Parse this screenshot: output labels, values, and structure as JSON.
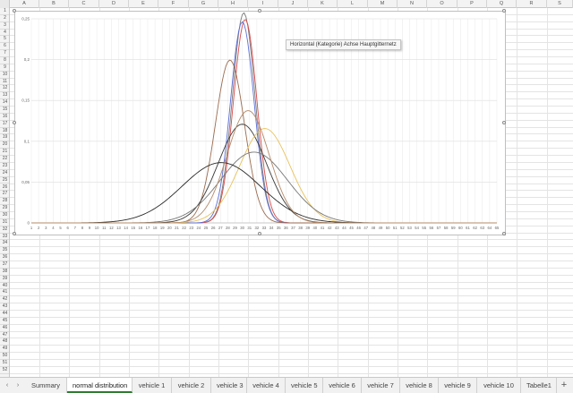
{
  "spreadsheet": {
    "columns": [
      "A",
      "B",
      "C",
      "D",
      "E",
      "F",
      "G",
      "H",
      "I",
      "J",
      "K",
      "L",
      "M",
      "N",
      "O",
      "P",
      "Q",
      "R",
      "S"
    ],
    "rows": [
      "1",
      "2",
      "3",
      "4",
      "5",
      "6",
      "7",
      "8",
      "9",
      "10",
      "11",
      "12",
      "13",
      "14",
      "15",
      "16",
      "17",
      "18",
      "19",
      "20",
      "21",
      "22",
      "23",
      "24",
      "25",
      "26",
      "27",
      "28",
      "29",
      "30",
      "31",
      "32",
      "33",
      "34",
      "35",
      "36",
      "37",
      "38",
      "39",
      "40",
      "41",
      "42",
      "43",
      "44",
      "45",
      "46",
      "47",
      "48",
      "49",
      "50",
      "51",
      "52"
    ]
  },
  "tooltip": {
    "text": "Horizontal (Kategorie) Achse Hauptgitternetz"
  },
  "sheet_tabs": {
    "prev_arrow": "‹",
    "next_arrow": "›",
    "add_label": "+",
    "active": "normal distribution",
    "tabs": [
      "Summary",
      "normal distribution",
      "vehicle 1",
      "vehicle 2",
      "vehicle 3",
      "vehicle 4",
      "vehicle 5",
      "vehicle 6",
      "vehicle 7",
      "vehicle 8",
      "vehicle 9",
      "vehicle 10",
      "Tabelle1"
    ]
  },
  "chart_data": {
    "type": "line",
    "x": [
      1,
      2,
      3,
      4,
      5,
      6,
      7,
      8,
      9,
      10,
      11,
      12,
      13,
      14,
      15,
      16,
      17,
      18,
      19,
      20,
      21,
      22,
      23,
      24,
      25,
      26,
      27,
      28,
      29,
      30,
      31,
      32,
      33,
      34,
      35,
      36,
      37,
      38,
      39,
      40,
      41,
      42,
      43,
      44,
      45,
      46,
      47,
      48,
      49,
      50,
      51,
      52,
      53,
      54,
      55,
      56,
      57,
      58,
      59,
      60,
      61,
      62,
      63,
      64,
      65
    ],
    "ylim": [
      0,
      0.25
    ],
    "yticks": [
      "0",
      "0,05",
      "0,1",
      "0,15",
      "0,2",
      "0,25"
    ],
    "grid": true,
    "legend": "none",
    "series_params": [
      {
        "mean": 30.2,
        "sd": 1.55,
        "color": "#7a7a7a"
      },
      {
        "mean": 30.4,
        "sd": 1.6,
        "color": "#d94b4b"
      },
      {
        "mean": 30.0,
        "sd": 1.62,
        "color": "#5b6fd6"
      },
      {
        "mean": 28.3,
        "sd": 2.0,
        "color": "#9a6b4f"
      },
      {
        "mean": 30.0,
        "sd": 3.3,
        "color": "#3a3a3a"
      },
      {
        "mean": 33.1,
        "sd": 3.45,
        "color": "#e8c25a"
      },
      {
        "mean": 31.6,
        "sd": 4.6,
        "color": "#777777"
      },
      {
        "mean": 27.1,
        "sd": 5.4,
        "color": "#2b2b2b"
      },
      {
        "mean": 30.8,
        "sd": 2.9,
        "color": "#b58b6a"
      }
    ]
  }
}
